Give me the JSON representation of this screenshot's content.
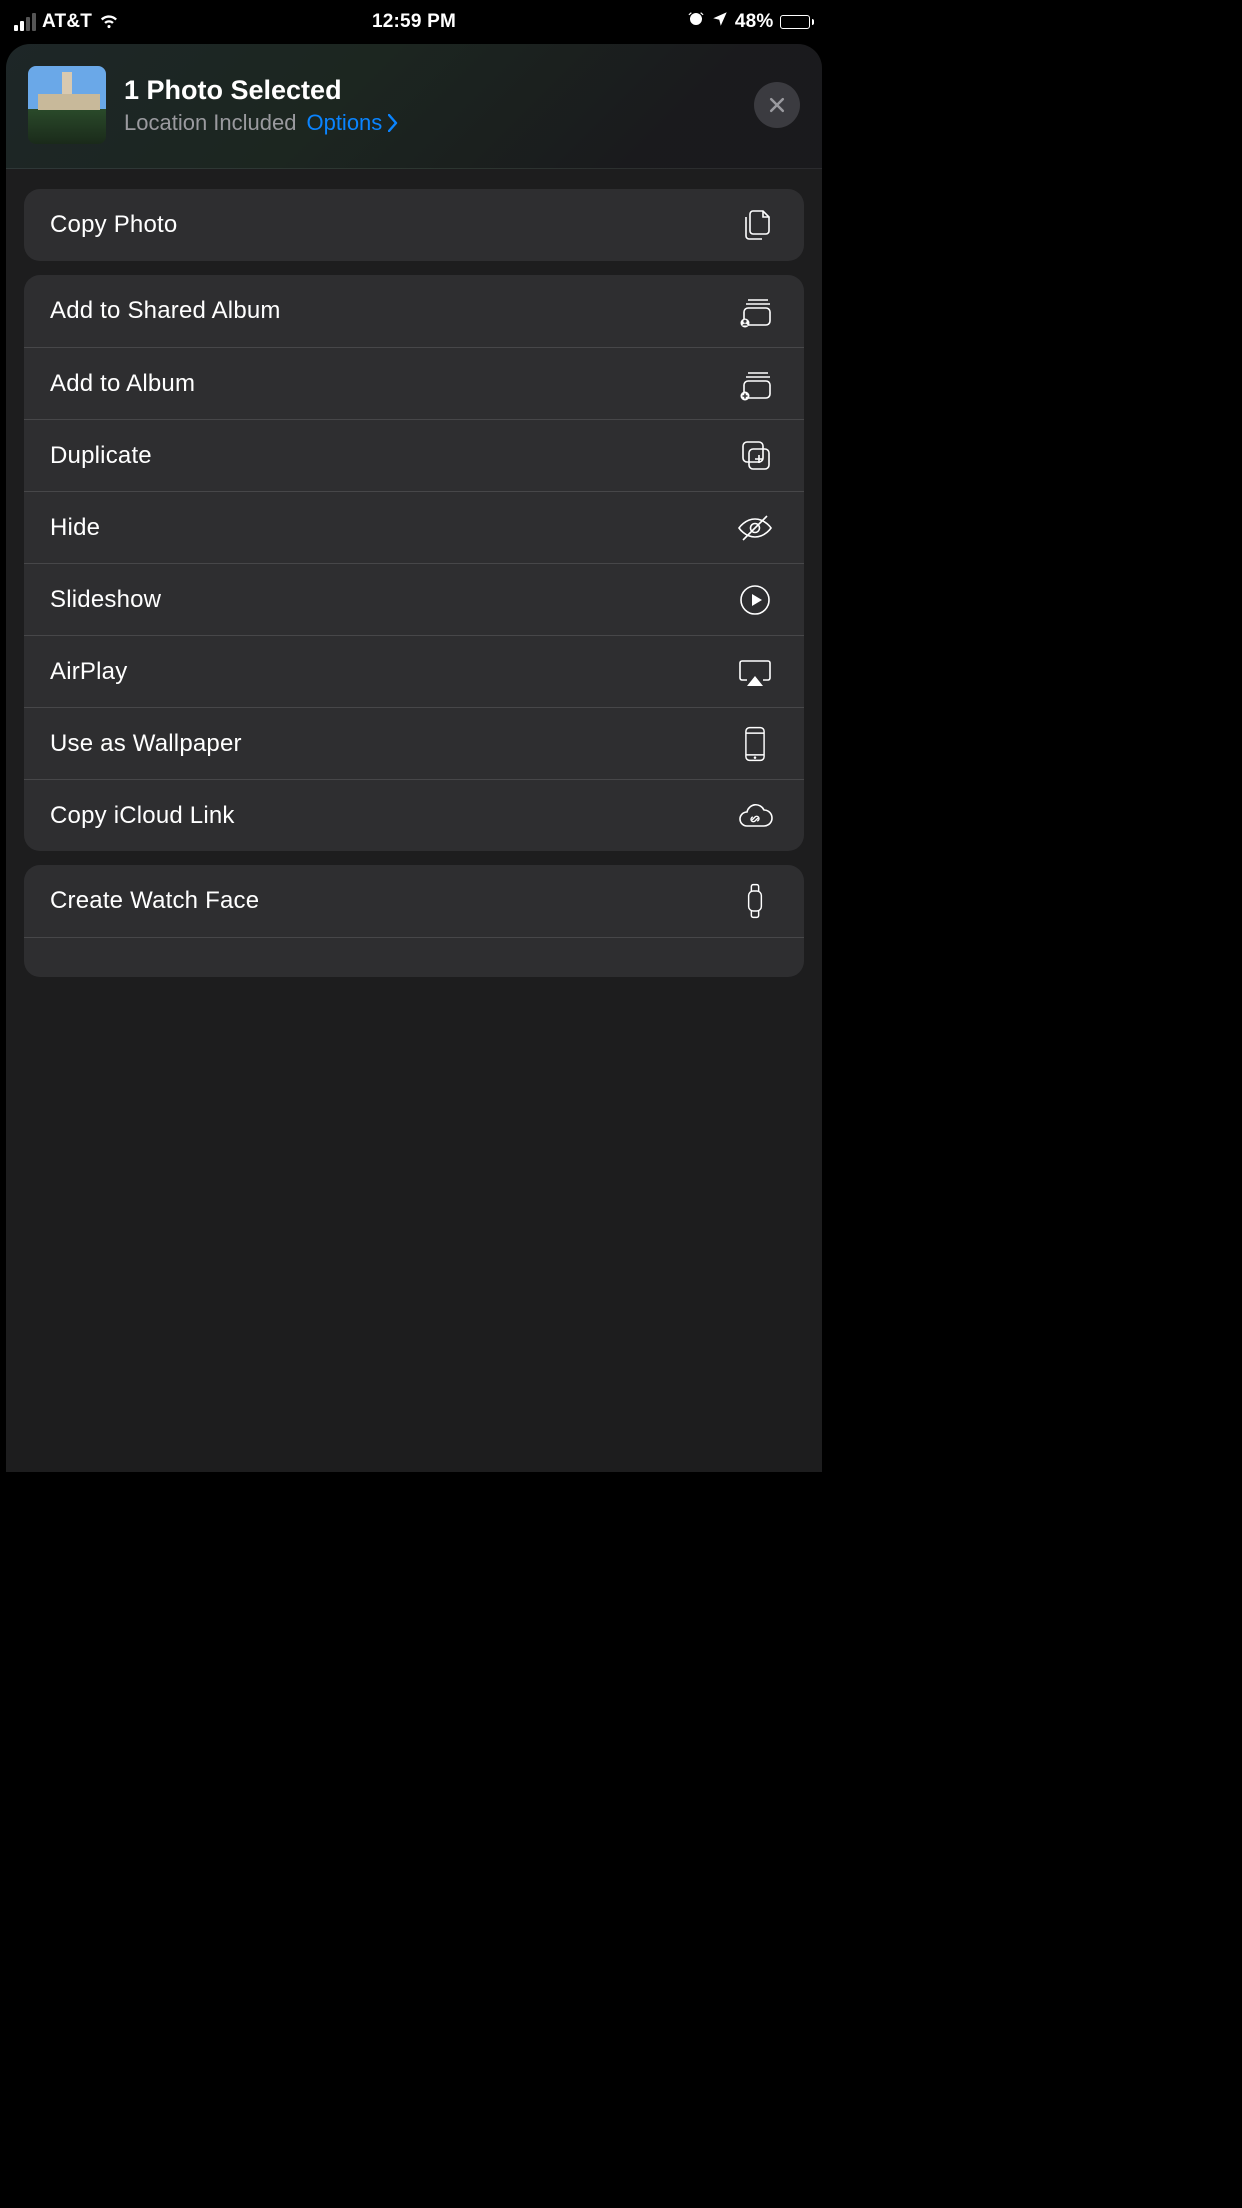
{
  "status_bar": {
    "carrier": "AT&T",
    "time": "12:59 PM",
    "battery_percent": "48%"
  },
  "sheet": {
    "header": {
      "title": "1 Photo Selected",
      "subtitle": "Location Included",
      "options_label": "Options"
    },
    "groups": [
      {
        "rows": [
          {
            "label": "Copy Photo",
            "icon": "copy-pages-icon"
          }
        ]
      },
      {
        "rows": [
          {
            "label": "Add to Shared Album",
            "icon": "shared-album-icon"
          },
          {
            "label": "Add to Album",
            "icon": "add-album-icon"
          },
          {
            "label": "Duplicate",
            "icon": "duplicate-icon"
          },
          {
            "label": "Hide",
            "icon": "hide-icon"
          },
          {
            "label": "Slideshow",
            "icon": "play-circle-icon"
          },
          {
            "label": "AirPlay",
            "icon": "airplay-icon"
          },
          {
            "label": "Use as Wallpaper",
            "icon": "phone-icon"
          },
          {
            "label": "Copy iCloud Link",
            "icon": "cloud-link-icon"
          }
        ]
      },
      {
        "rows": [
          {
            "label": "Create Watch Face",
            "icon": "watch-icon"
          }
        ]
      }
    ]
  }
}
